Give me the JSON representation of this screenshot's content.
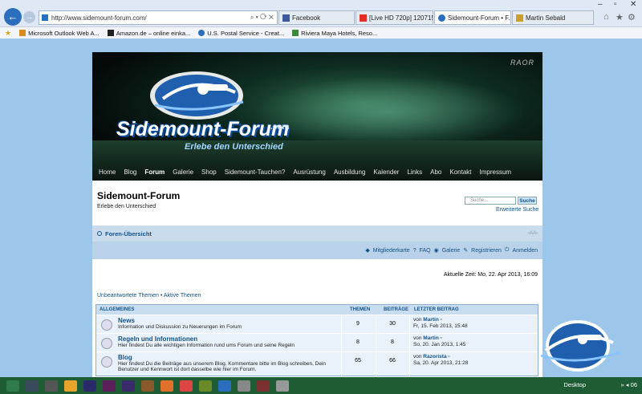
{
  "browser": {
    "url": "http://www.sidemount-forum.com/",
    "addr_controls": "⌕ ▾ ⟳ ✕",
    "tabs": [
      {
        "label": "Facebook",
        "color": "#3b5998"
      },
      {
        "label": "[Live HD 720p] 120715 - P...",
        "color": "#e52d27"
      },
      {
        "label": "Sidemount-Forum • F...",
        "color": "#2a6ebd",
        "active": true
      },
      {
        "label": "Martin Sebald",
        "color": "#c7a02e"
      }
    ],
    "favorites": [
      {
        "label": "Microsoft Outlook Web A...",
        "color": "#d98b1e"
      },
      {
        "label": "Amazon.de – online einka...",
        "color": "#222"
      },
      {
        "label": "U.S. Postal Service - Creat...",
        "color": "#2a6ebd"
      },
      {
        "label": "Riviera Maya Hotels, Reso...",
        "color": "#3a8a3a"
      }
    ]
  },
  "banner": {
    "site_name": "Sidemount-Forum",
    "dotcom": ".com",
    "claim": "Erlebe den Unterschied",
    "brand": "RAOR"
  },
  "nav": [
    "Home",
    "Blog",
    "Forum",
    "Galerie",
    "Shop",
    "Sidemount-Tauchen?",
    "Ausrüstung",
    "Ausbildung",
    "Kalender",
    "Links",
    "Abo",
    "Kontakt",
    "Impressum"
  ],
  "header": {
    "title": "Sidemount-Forum",
    "subtitle": "Erlebe den Unterschied",
    "search_placeholder": "Suche...",
    "search_button": "Suche",
    "advanced": "Erweiterte Suche"
  },
  "breadcrumb": "Foren-Übersicht",
  "font_resize": "‹AA›",
  "toolbar": [
    "Mitgliederkarte",
    "FAQ",
    "Galerie",
    "Registrieren",
    "Anmelden"
  ],
  "current_time": "Aktuelle Zeit: Mo, 22. Apr 2013, 16:09",
  "quick_links": "Unbeantwortete Themen • Aktive Themen",
  "forum_header": {
    "section": "ALLGEMEINES",
    "topics": "THEMEN",
    "posts": "BEITRÄGE",
    "last": "LETZTER BEITRAG"
  },
  "forums": [
    {
      "title": "News",
      "desc": "Information und Diskussion zu Neuerungen im Forum",
      "topics": "9",
      "posts": "30",
      "by": "von",
      "author": "Martin",
      "date": "Fr, 15. Feb 2013, 15:48"
    },
    {
      "title": "Regeln und Informationen",
      "desc": "Hier findest Du alle wichtigen Information rund ums Forum und seine Regeln",
      "topics": "8",
      "posts": "8",
      "by": "von",
      "author": "Martin",
      "date": "So, 20. Jan 2013, 1:45"
    },
    {
      "title": "Blog",
      "desc": "Hier findest Du die Beiträge aus unserem Blog. Kommentare bitte im Blog schreiben, Dein Benutzer und Kennwort ist dort dasselbe wie hier im Forum.",
      "topics": "65",
      "posts": "66",
      "by": "von",
      "author": "Razorista",
      "date": "Sa, 20. Apr 2013, 21:28"
    }
  ],
  "taskbar": {
    "desktop": "Desktop",
    "tray": "»  ◂  06"
  }
}
